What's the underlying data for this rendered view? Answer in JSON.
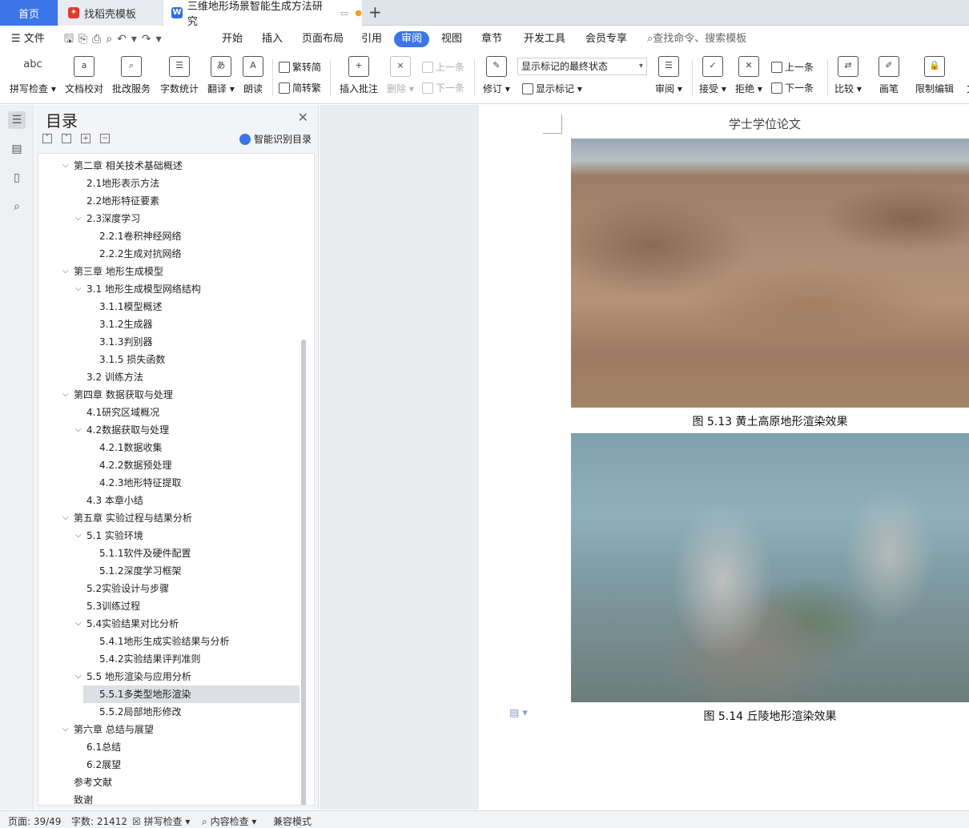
{
  "tabs": {
    "home": "首页",
    "template": "找稻壳模板",
    "document": "三维地形场景智能生成方法研究"
  },
  "menu": {
    "file": "文件",
    "items": [
      "开始",
      "插入",
      "页面布局",
      "引用",
      "审阅",
      "视图",
      "章节",
      "开发工具",
      "会员专享"
    ],
    "active": "审阅",
    "search": "查找命令、搜索模板"
  },
  "toolbar": {
    "spell": "拼写检查",
    "proof": "文档校对",
    "revise_service": "批改服务",
    "word_count": "字数统计",
    "translate": "翻译",
    "read": "朗读",
    "trad": "繁转简",
    "simp": "简转繁",
    "insert_comment": "插入批注",
    "delete": "删除",
    "prev1": "上一条",
    "next1": "下一条",
    "track": "修订",
    "markup_state": "显示标记的最终状态",
    "show_markup": "显示标记",
    "review": "审阅",
    "accept": "接受",
    "reject": "拒绝",
    "prev2": "上一条",
    "next2": "下一条",
    "compare": "比较",
    "pen": "画笔",
    "restrict": "限制编辑",
    "doc": "文"
  },
  "toc": {
    "title": "目录",
    "smart": "智能识别目录",
    "items": [
      {
        "t": "第二章 相关技术基础概述",
        "lv": 0,
        "c": 1
      },
      {
        "t": "2.1地形表示方法",
        "lv": 1,
        "c": 0
      },
      {
        "t": "2.2地形特征要素",
        "lv": 1,
        "c": 0
      },
      {
        "t": "2.3深度学习",
        "lv": 1,
        "c": 1
      },
      {
        "t": "2.2.1卷积神经网络",
        "lv": 2,
        "c": 0
      },
      {
        "t": "2.2.2生成对抗网络",
        "lv": 2,
        "c": 0
      },
      {
        "t": "第三章 地形生成模型",
        "lv": 0,
        "c": 1
      },
      {
        "t": "3.1 地形生成模型网络结构",
        "lv": 1,
        "c": 1
      },
      {
        "t": "3.1.1模型概述",
        "lv": 2,
        "c": 0
      },
      {
        "t": "3.1.2生成器",
        "lv": 2,
        "c": 0
      },
      {
        "t": "3.1.3判别器",
        "lv": 2,
        "c": 0
      },
      {
        "t": "3.1.5 损失函数",
        "lv": 2,
        "c": 0
      },
      {
        "t": "3.2 训练方法",
        "lv": 1,
        "c": 0
      },
      {
        "t": "第四章 数据获取与处理",
        "lv": 0,
        "c": 1
      },
      {
        "t": "4.1研究区域概况",
        "lv": 1,
        "c": 0
      },
      {
        "t": "4.2数据获取与处理",
        "lv": 1,
        "c": 1
      },
      {
        "t": "4.2.1数据收集",
        "lv": 2,
        "c": 0
      },
      {
        "t": "4.2.2数据预处理",
        "lv": 2,
        "c": 0
      },
      {
        "t": "4.2.3地形特征提取",
        "lv": 2,
        "c": 0
      },
      {
        "t": "4.3 本章小结",
        "lv": 1,
        "c": 0
      },
      {
        "t": "第五章 实验过程与结果分析",
        "lv": 0,
        "c": 1
      },
      {
        "t": "5.1 实验环境",
        "lv": 1,
        "c": 1
      },
      {
        "t": "5.1.1软件及硬件配置",
        "lv": 2,
        "c": 0
      },
      {
        "t": "5.1.2深度学习框架",
        "lv": 2,
        "c": 0
      },
      {
        "t": "5.2实验设计与步骤",
        "lv": 1,
        "c": 0
      },
      {
        "t": "5.3训练过程",
        "lv": 1,
        "c": 0
      },
      {
        "t": "5.4实验结果对比分析",
        "lv": 1,
        "c": 1
      },
      {
        "t": "5.4.1地形生成实验结果与分析",
        "lv": 2,
        "c": 0
      },
      {
        "t": "5.4.2实验结果评判准则",
        "lv": 2,
        "c": 0
      },
      {
        "t": "5.5 地形渲染与应用分析",
        "lv": 1,
        "c": 1
      },
      {
        "t": "5.5.1多类型地形渲染",
        "lv": 2,
        "c": 0,
        "sel": 1
      },
      {
        "t": "5.5.2局部地形修改",
        "lv": 2,
        "c": 0
      },
      {
        "t": "第六章 总结与展望",
        "lv": 0,
        "c": 1
      },
      {
        "t": "6.1总结",
        "lv": 1,
        "c": 0
      },
      {
        "t": "6.2展望",
        "lv": 1,
        "c": 0
      },
      {
        "t": "参考文献",
        "lv": 0,
        "c": 0
      },
      {
        "t": "致谢",
        "lv": 0,
        "c": 0
      }
    ]
  },
  "page": {
    "header": "学士学位论文",
    "caption1": "图  5.13 黄土高原地形渲染效果",
    "caption2": "图  5.14 丘陵地形渲染效果"
  },
  "status": {
    "page": "页面: 39/49",
    "words": "字数: 21412",
    "spell": "拼写检查",
    "content": "内容检查",
    "compat": "兼容模式"
  }
}
